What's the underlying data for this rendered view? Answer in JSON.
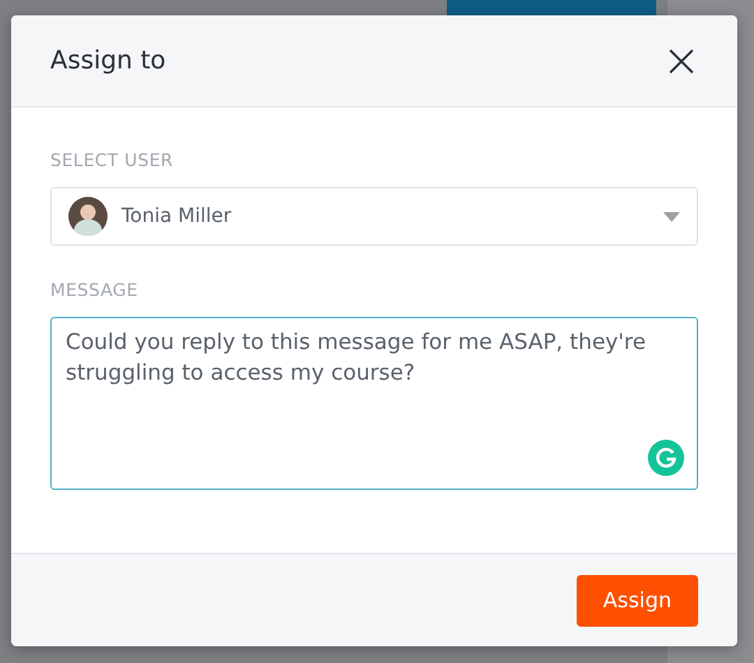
{
  "dialog": {
    "title": "Assign to",
    "user_field": {
      "label": "SELECT USER",
      "value": "Tonia Miller"
    },
    "message_field": {
      "label": "MESSAGE",
      "value": "Could you reply to this message for me ASAP, they're struggling to access my course?",
      "focused": true
    },
    "buttons": [
      "Assign"
    ]
  }
}
